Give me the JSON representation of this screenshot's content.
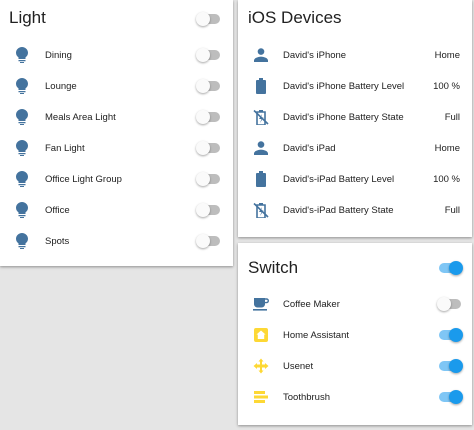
{
  "colors": {
    "bulb_icon": "#44739e",
    "person_icon": "#44739e",
    "yellow_icon": "#fdd835",
    "toggle_on": "#1a9aec",
    "toggle_off": "#bdbdbd"
  },
  "light_card": {
    "title": "Light",
    "header_toggle_on": false,
    "items": [
      {
        "label": "Dining",
        "icon": "lightbulb-icon",
        "on": false
      },
      {
        "label": "Lounge",
        "icon": "lightbulb-icon",
        "on": false
      },
      {
        "label": "Meals Area Light",
        "icon": "lightbulb-icon",
        "on": false
      },
      {
        "label": "Fan Light",
        "icon": "lightbulb-icon",
        "on": false
      },
      {
        "label": "Office Light Group",
        "icon": "lightbulb-icon",
        "on": false
      },
      {
        "label": "Office",
        "icon": "lightbulb-icon",
        "on": false
      },
      {
        "label": "Spots",
        "icon": "lightbulb-icon",
        "on": false
      }
    ]
  },
  "ios_card": {
    "title": "iOS Devices",
    "items": [
      {
        "label": "David's iPhone",
        "value": "Home",
        "icon": "person-icon"
      },
      {
        "label": "David's iPhone Battery Level",
        "value": "100 %",
        "icon": "battery-icon"
      },
      {
        "label": "David's iPhone Battery State",
        "value": "Full",
        "icon": "battery-charging-off-icon"
      },
      {
        "label": "David's iPad",
        "value": "Home",
        "icon": "person-icon"
      },
      {
        "label": "David's-iPad Battery Level",
        "value": "100 %",
        "icon": "battery-icon"
      },
      {
        "label": "David's-iPad Battery State",
        "value": "Full",
        "icon": "battery-charging-off-icon"
      }
    ]
  },
  "switch_card": {
    "title": "Switch",
    "header_toggle_on": true,
    "items": [
      {
        "label": "Coffee Maker",
        "icon": "coffee-icon",
        "on": false
      },
      {
        "label": "Home Assistant",
        "icon": "home-assistant-icon",
        "on": true
      },
      {
        "label": "Usenet",
        "icon": "usenet-icon",
        "on": true
      },
      {
        "label": "Toothbrush",
        "icon": "toothbrush-icon",
        "on": true
      }
    ]
  }
}
